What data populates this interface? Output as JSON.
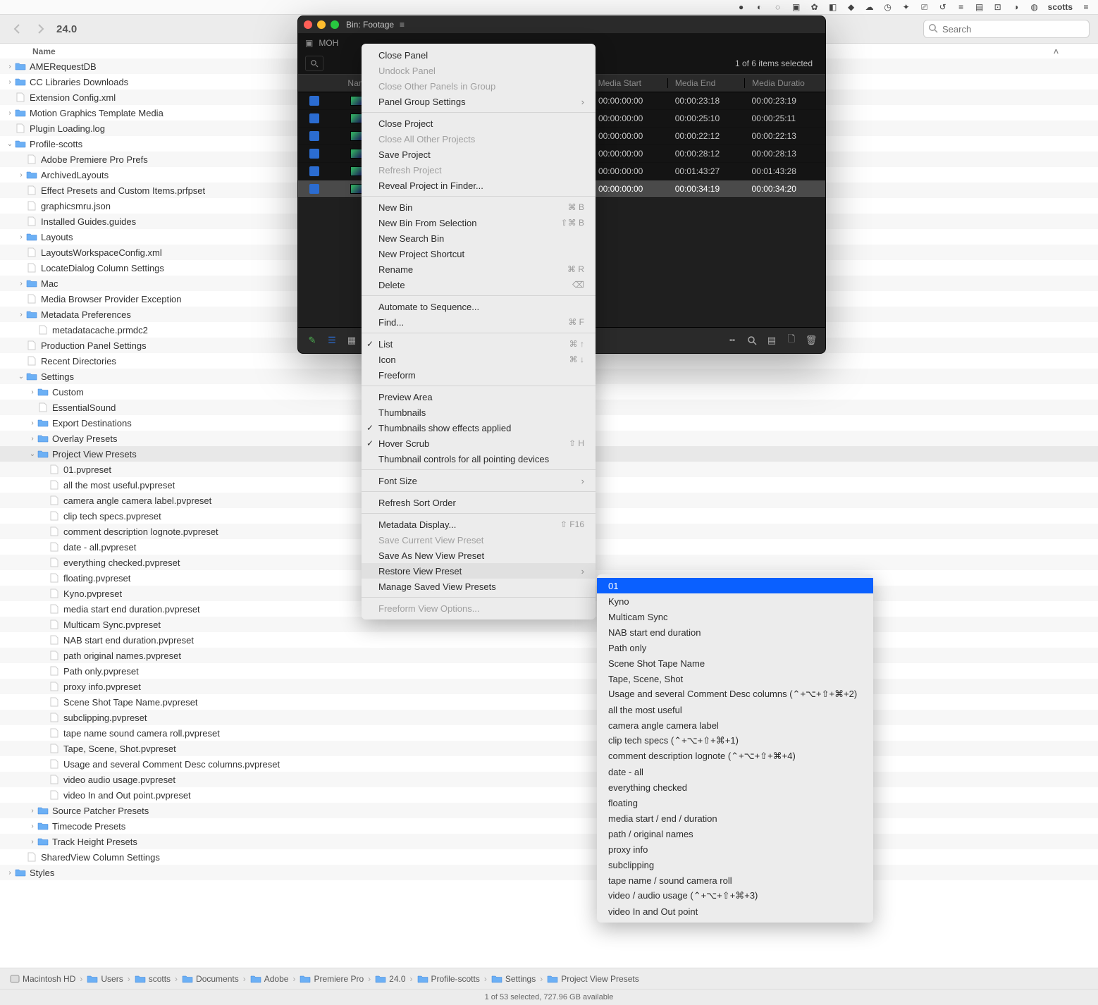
{
  "menubar": {
    "username": "scotts"
  },
  "toolbar": {
    "title": "24.0",
    "search_placeholder": "Search"
  },
  "column_header": {
    "name": "Name"
  },
  "tree": [
    {
      "d": 0,
      "disc": ">",
      "type": "folder",
      "label": "AMERequestDB"
    },
    {
      "d": 0,
      "disc": ">",
      "type": "folder",
      "label": "CC Libraries Downloads"
    },
    {
      "d": 0,
      "disc": "",
      "type": "file",
      "label": "Extension Config.xml"
    },
    {
      "d": 0,
      "disc": ">",
      "type": "folder",
      "label": "Motion Graphics Template Media"
    },
    {
      "d": 0,
      "disc": "",
      "type": "file",
      "label": "Plugin Loading.log"
    },
    {
      "d": 0,
      "disc": "v",
      "type": "folder",
      "label": "Profile-scotts"
    },
    {
      "d": 1,
      "disc": "",
      "type": "file",
      "label": "Adobe Premiere Pro Prefs"
    },
    {
      "d": 1,
      "disc": ">",
      "type": "folder",
      "label": "ArchivedLayouts"
    },
    {
      "d": 1,
      "disc": "",
      "type": "file",
      "label": "Effect Presets and Custom Items.prfpset"
    },
    {
      "d": 1,
      "disc": "",
      "type": "file",
      "label": "graphicsmru.json"
    },
    {
      "d": 1,
      "disc": "",
      "type": "file",
      "label": "Installed Guides.guides"
    },
    {
      "d": 1,
      "disc": ">",
      "type": "folder",
      "label": "Layouts"
    },
    {
      "d": 1,
      "disc": "",
      "type": "file",
      "label": "LayoutsWorkspaceConfig.xml"
    },
    {
      "d": 1,
      "disc": "",
      "type": "file",
      "label": "LocateDialog Column Settings"
    },
    {
      "d": 1,
      "disc": ">",
      "type": "folder",
      "label": "Mac"
    },
    {
      "d": 1,
      "disc": "",
      "type": "file",
      "label": "Media Browser Provider Exception"
    },
    {
      "d": 1,
      "disc": ">",
      "type": "folder",
      "label": "Metadata Preferences"
    },
    {
      "d": 2,
      "disc": "",
      "type": "file",
      "label": "metadatacache.prmdc2"
    },
    {
      "d": 1,
      "disc": "",
      "type": "file",
      "label": "Production Panel Settings"
    },
    {
      "d": 1,
      "disc": "",
      "type": "file",
      "label": "Recent Directories"
    },
    {
      "d": 1,
      "disc": "v",
      "type": "folder",
      "label": "Settings"
    },
    {
      "d": 2,
      "disc": ">",
      "type": "folder",
      "label": "Custom"
    },
    {
      "d": 2,
      "disc": "",
      "type": "file",
      "label": "EssentialSound"
    },
    {
      "d": 2,
      "disc": ">",
      "type": "folder",
      "label": "Export Destinations"
    },
    {
      "d": 2,
      "disc": ">",
      "type": "folder",
      "label": "Overlay Presets"
    },
    {
      "d": 2,
      "disc": "v",
      "type": "folder",
      "label": "Project View Presets",
      "selected": true
    },
    {
      "d": 3,
      "disc": "",
      "type": "file",
      "label": "01.pvpreset"
    },
    {
      "d": 3,
      "disc": "",
      "type": "file",
      "label": "all the most useful.pvpreset"
    },
    {
      "d": 3,
      "disc": "",
      "type": "file",
      "label": "camera angle camera label.pvpreset"
    },
    {
      "d": 3,
      "disc": "",
      "type": "file",
      "label": "clip tech specs.pvpreset"
    },
    {
      "d": 3,
      "disc": "",
      "type": "file",
      "label": "comment description lognote.pvpreset"
    },
    {
      "d": 3,
      "disc": "",
      "type": "file",
      "label": "date - all.pvpreset"
    },
    {
      "d": 3,
      "disc": "",
      "type": "file",
      "label": "everything checked.pvpreset"
    },
    {
      "d": 3,
      "disc": "",
      "type": "file",
      "label": "floating.pvpreset"
    },
    {
      "d": 3,
      "disc": "",
      "type": "file",
      "label": "Kyno.pvpreset"
    },
    {
      "d": 3,
      "disc": "",
      "type": "file",
      "label": "media start  end  duration.pvpreset"
    },
    {
      "d": 3,
      "disc": "",
      "type": "file",
      "label": "Multicam Sync.pvpreset"
    },
    {
      "d": 3,
      "disc": "",
      "type": "file",
      "label": "NAB start end duration.pvpreset"
    },
    {
      "d": 3,
      "disc": "",
      "type": "file",
      "label": "path  original names.pvpreset"
    },
    {
      "d": 3,
      "disc": "",
      "type": "file",
      "label": "Path only.pvpreset"
    },
    {
      "d": 3,
      "disc": "",
      "type": "file",
      "label": "proxy info.pvpreset"
    },
    {
      "d": 3,
      "disc": "",
      "type": "file",
      "label": "Scene Shot Tape Name.pvpreset"
    },
    {
      "d": 3,
      "disc": "",
      "type": "file",
      "label": "subclipping.pvpreset"
    },
    {
      "d": 3,
      "disc": "",
      "type": "file",
      "label": "tape name  sound camera roll.pvpreset"
    },
    {
      "d": 3,
      "disc": "",
      "type": "file",
      "label": "Tape, Scene, Shot.pvpreset"
    },
    {
      "d": 3,
      "disc": "",
      "type": "file",
      "label": "Usage and several Comment Desc columns.pvpreset"
    },
    {
      "d": 3,
      "disc": "",
      "type": "file",
      "label": "video  audio usage.pvpreset"
    },
    {
      "d": 3,
      "disc": "",
      "type": "file",
      "label": "video In and Out point.pvpreset"
    },
    {
      "d": 2,
      "disc": ">",
      "type": "folder",
      "label": "Source Patcher Presets"
    },
    {
      "d": 2,
      "disc": ">",
      "type": "folder",
      "label": "Timecode Presets"
    },
    {
      "d": 2,
      "disc": ">",
      "type": "folder",
      "label": "Track Height Presets"
    },
    {
      "d": 1,
      "disc": "",
      "type": "file",
      "label": "SharedView Column Settings"
    },
    {
      "d": 0,
      "disc": ">",
      "type": "folder",
      "label": "Styles"
    }
  ],
  "pathbar": [
    "Macintosh HD",
    "Users",
    "scotts",
    "Documents",
    "Adobe",
    "Premiere Pro",
    "24.0",
    "Profile-scotts",
    "Settings",
    "Project View Presets"
  ],
  "statusbar": "1 of 53 selected, 727.96 GB available",
  "dark_panel": {
    "bin_title": "Bin: Footage",
    "tab": "MOH",
    "selection": "1 of 6 items selected",
    "columns": [
      "Name",
      "",
      "Media Start",
      "Media End",
      "Media Duratio"
    ],
    "rows": [
      {
        "start": "00:00:00:00",
        "end": "00:00:23:18",
        "dur": "00:00:23:19"
      },
      {
        "start": "00:00:00:00",
        "end": "00:00:25:10",
        "dur": "00:00:25:11"
      },
      {
        "start": "00:00:00:00",
        "end": "00:00:22:12",
        "dur": "00:00:22:13"
      },
      {
        "start": "00:00:00:00",
        "end": "00:00:28:12",
        "dur": "00:00:28:13"
      },
      {
        "start": "00:00:00:00",
        "end": "00:01:43:27",
        "dur": "00:01:43:28"
      },
      {
        "start": "00:00:00:00",
        "end": "00:00:34:19",
        "dur": "00:00:34:20",
        "selected": true
      }
    ]
  },
  "context_menu": [
    {
      "type": "item",
      "label": "Close Panel"
    },
    {
      "type": "item",
      "label": "Undock Panel",
      "disabled": true
    },
    {
      "type": "item",
      "label": "Close Other Panels in Group",
      "disabled": true
    },
    {
      "type": "item",
      "label": "Panel Group Settings",
      "sub": true
    },
    {
      "type": "sep"
    },
    {
      "type": "item",
      "label": "Close Project"
    },
    {
      "type": "item",
      "label": "Close All Other Projects",
      "disabled": true
    },
    {
      "type": "item",
      "label": "Save Project"
    },
    {
      "type": "item",
      "label": "Refresh Project",
      "disabled": true
    },
    {
      "type": "item",
      "label": "Reveal Project in Finder..."
    },
    {
      "type": "sep"
    },
    {
      "type": "item",
      "label": "New Bin",
      "shortcut": "⌘ B"
    },
    {
      "type": "item",
      "label": "New Bin From Selection",
      "shortcut": "⇧⌘ B"
    },
    {
      "type": "item",
      "label": "New Search Bin"
    },
    {
      "type": "item",
      "label": "New Project Shortcut"
    },
    {
      "type": "item",
      "label": "Rename",
      "shortcut": "⌘ R"
    },
    {
      "type": "item",
      "label": "Delete",
      "shortcut": "⌫"
    },
    {
      "type": "sep"
    },
    {
      "type": "item",
      "label": "Automate to Sequence..."
    },
    {
      "type": "item",
      "label": "Find...",
      "shortcut": "⌘ F"
    },
    {
      "type": "sep"
    },
    {
      "type": "item",
      "label": "List",
      "shortcut": "⌘ ↑",
      "checked": true
    },
    {
      "type": "item",
      "label": "Icon",
      "shortcut": "⌘ ↓"
    },
    {
      "type": "item",
      "label": "Freeform"
    },
    {
      "type": "sep"
    },
    {
      "type": "item",
      "label": "Preview Area"
    },
    {
      "type": "item",
      "label": "Thumbnails"
    },
    {
      "type": "item",
      "label": "Thumbnails show effects applied",
      "checked": true
    },
    {
      "type": "item",
      "label": "Hover Scrub",
      "shortcut": "⇧ H",
      "checked": true
    },
    {
      "type": "item",
      "label": "Thumbnail controls for all pointing devices"
    },
    {
      "type": "sep"
    },
    {
      "type": "item",
      "label": "Font Size",
      "sub": true
    },
    {
      "type": "sep"
    },
    {
      "type": "item",
      "label": "Refresh Sort Order"
    },
    {
      "type": "sep"
    },
    {
      "type": "item",
      "label": "Metadata Display...",
      "shortcut": "⇧ F16"
    },
    {
      "type": "item",
      "label": "Save Current View Preset",
      "disabled": true
    },
    {
      "type": "item",
      "label": "Save As New View Preset"
    },
    {
      "type": "item",
      "label": "Restore View Preset",
      "sub": true,
      "highlight": true
    },
    {
      "type": "item",
      "label": "Manage Saved View Presets"
    },
    {
      "type": "sep"
    },
    {
      "type": "item",
      "label": "Freeform View Options...",
      "disabled": true
    }
  ],
  "submenu": [
    {
      "label": "01",
      "selected": true
    },
    {
      "label": "Kyno"
    },
    {
      "label": "Multicam Sync"
    },
    {
      "label": "NAB start end duration"
    },
    {
      "label": "Path only"
    },
    {
      "label": "Scene Shot Tape Name"
    },
    {
      "label": "Tape, Scene, Shot"
    },
    {
      "label": "Usage and several Comment Desc columns (⌃+⌥+⇧+⌘+2)"
    },
    {
      "label": "all the most useful"
    },
    {
      "label": "camera angle camera label"
    },
    {
      "label": "clip tech specs (⌃+⌥+⇧+⌘+1)"
    },
    {
      "label": "comment description lognote (⌃+⌥+⇧+⌘+4)"
    },
    {
      "label": "date - all"
    },
    {
      "label": "everything checked"
    },
    {
      "label": "floating"
    },
    {
      "label": "media start / end / duration"
    },
    {
      "label": "path / original names"
    },
    {
      "label": "proxy info"
    },
    {
      "label": "subclipping"
    },
    {
      "label": "tape name / sound camera roll"
    },
    {
      "label": "video / audio usage (⌃+⌥+⇧+⌘+3)"
    },
    {
      "label": "video In and Out point"
    }
  ]
}
